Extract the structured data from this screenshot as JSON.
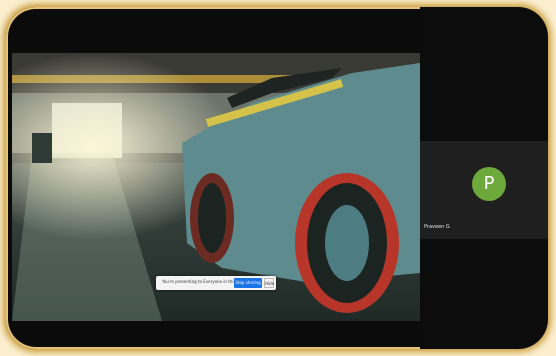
{
  "meeting": {
    "participant": {
      "initial": "P",
      "name": "Praveen G"
    }
  },
  "banner": {
    "message": "You're presenting to Everyone in this meeting",
    "stop_label": "Stop sharing",
    "hide_label": "Hide"
  },
  "colors": {
    "frame_glow": "#c79b3a",
    "avatar_bg": "#6da83b",
    "accent": "#1a73e8"
  }
}
